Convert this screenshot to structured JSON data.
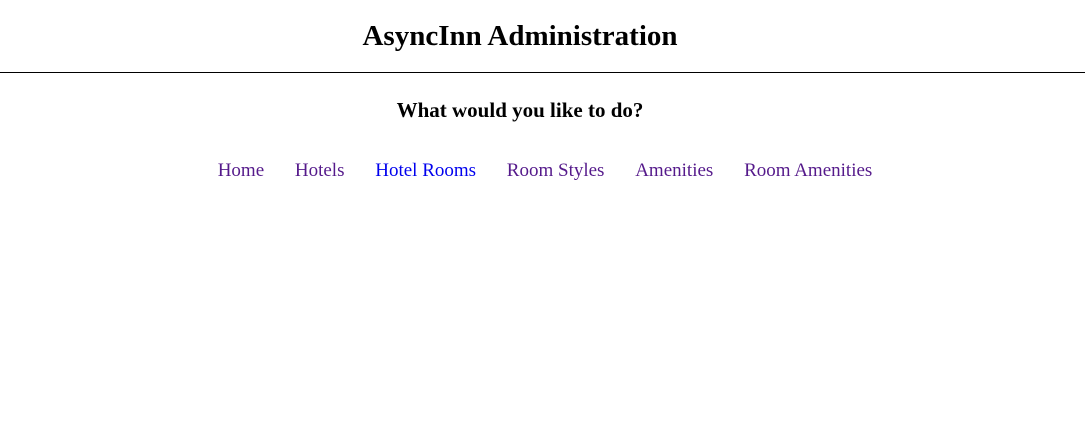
{
  "header": {
    "title": "AsyncInn Administration"
  },
  "main": {
    "prompt": "What would you like to do?"
  },
  "nav": {
    "links": [
      {
        "label": "Home",
        "color": "#551a8b"
      },
      {
        "label": "Hotels",
        "color": "#551a8b"
      },
      {
        "label": "Hotel Rooms",
        "color": "#0000ee"
      },
      {
        "label": "Room Styles",
        "color": "#551a8b"
      },
      {
        "label": "Amenities",
        "color": "#551a8b"
      },
      {
        "label": "Room Amenities",
        "color": "#551a8b"
      }
    ]
  },
  "colors": {
    "background": "#ffffff",
    "text": "#000000",
    "divider": "#000000",
    "visited_link": "#551a8b",
    "unvisited_link": "#0000ee"
  }
}
